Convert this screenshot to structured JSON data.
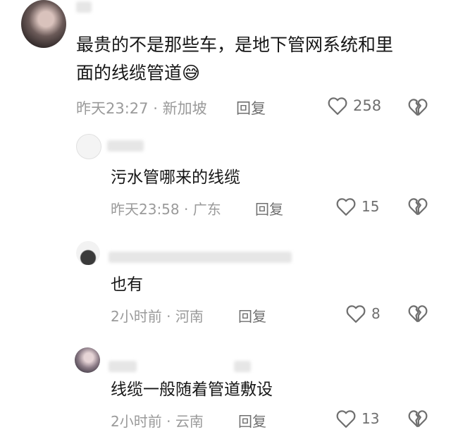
{
  "comments": [
    {
      "text_lines": [
        "最贵的不是那些车，是地下管网系统和里",
        "面的线缆管道😅"
      ],
      "time": "昨天23:27",
      "location": "新加坡",
      "reply_label": "回复",
      "likes": "258"
    },
    {
      "text_lines": [
        "污水管哪来的线缆"
      ],
      "time": "昨天23:58",
      "location": "广东",
      "reply_label": "回复",
      "likes": "15"
    },
    {
      "text_lines": [
        "也有"
      ],
      "time": "2小时前",
      "location": "河南",
      "reply_label": "回复",
      "likes": "8"
    },
    {
      "text_lines": [
        "线缆一般随着管道敷设"
      ],
      "time": "2小时前",
      "location": "云南",
      "reply_label": "回复",
      "likes": "13"
    }
  ],
  "separator": "·",
  "icons": {
    "like": "heart-outline-icon",
    "dislike": "broken-heart-icon"
  },
  "colors": {
    "text": "#161616",
    "meta": "#9a9a9a",
    "icon": "#6f6f6f"
  }
}
